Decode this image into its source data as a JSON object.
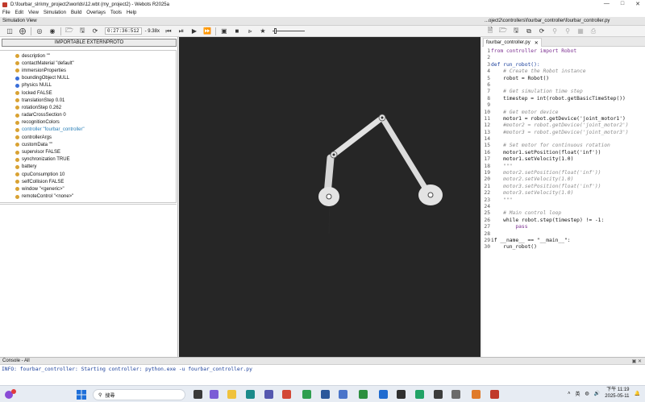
{
  "window": {
    "title": "D:\\fourbar_sln\\my_project2\\worlds\\12.wbt (my_project2) - Webots R2025a"
  },
  "menu": [
    "File",
    "Edit",
    "View",
    "Simulation",
    "Build",
    "Overlays",
    "Tools",
    "Help"
  ],
  "simulation_view": {
    "label": "Simulation View",
    "time": "0:27:36:512",
    "speed": "- 9.38x"
  },
  "scene_tree": {
    "button_label": "IMPORTABLE EXTERNPROTO",
    "fields": [
      {
        "text": "description \"\"",
        "dot": "orange"
      },
      {
        "text": "contactMaterial \"default\"",
        "dot": "orange"
      },
      {
        "text": "immersionProperties",
        "dot": "orange"
      },
      {
        "text": "boundingObject NULL",
        "dot": "blue"
      },
      {
        "text": "physics NULL",
        "dot": "blue"
      },
      {
        "text": "locked FALSE",
        "dot": "orange"
      },
      {
        "text": "translationStep 0.01",
        "dot": "orange"
      },
      {
        "text": "rotationStep 0.262",
        "dot": "orange"
      },
      {
        "text": "radarCrossSection 0",
        "dot": "orange"
      },
      {
        "text": "recognitionColors",
        "dot": "orange"
      },
      {
        "text": "controller \"fourbar_controller\"",
        "dot": "orange",
        "highlight": true
      },
      {
        "text": "controllerArgs",
        "dot": "orange"
      },
      {
        "text": "customData \"\"",
        "dot": "orange"
      },
      {
        "text": "supervisor FALSE",
        "dot": "orange"
      },
      {
        "text": "synchronization TRUE",
        "dot": "orange"
      },
      {
        "text": "battery",
        "dot": "orange"
      },
      {
        "text": "cpuConsumption 10",
        "dot": "orange"
      },
      {
        "text": "selfCollision FALSE",
        "dot": "orange"
      },
      {
        "text": "window \"<generic>\"",
        "dot": "orange"
      },
      {
        "text": "remoteControl \"<none>\"",
        "dot": "orange"
      }
    ]
  },
  "editor": {
    "path": "...oject2\\controllers\\fourbar_controller\\fourbar_controller.py",
    "tab": "fourbar_controller.py",
    "line_numbers": [
      "1",
      "2",
      "3",
      "4",
      "5",
      "6",
      "7",
      "8",
      "9",
      "10",
      "11",
      "12",
      "13",
      "14",
      "15",
      "16",
      "17",
      "18",
      "19",
      "20",
      "21",
      "22",
      "23",
      "24",
      "25",
      "26",
      "27",
      "28",
      "29",
      "30"
    ],
    "lines": [
      {
        "t": "from controller import Robot",
        "c": "kw"
      },
      {
        "t": "",
        "c": ""
      },
      {
        "t": "def run_robot():",
        "c": "fn"
      },
      {
        "t": "    # Create the Robot instance",
        "c": "cm"
      },
      {
        "t": "    robot = Robot()",
        "c": ""
      },
      {
        "t": "",
        "c": ""
      },
      {
        "t": "    # Get simulation time step",
        "c": "cm"
      },
      {
        "t": "    timestep = int(robot.getBasicTimeStep())",
        "c": ""
      },
      {
        "t": "",
        "c": ""
      },
      {
        "t": "    # Get motor device",
        "c": "cm"
      },
      {
        "t": "    motor1 = robot.getDevice('joint_motor1')",
        "c": ""
      },
      {
        "t": "    #motor2 = robot.getDevice('joint_motor2')",
        "c": "cm"
      },
      {
        "t": "    #motor3 = robot.getDevice('joint_motor3')",
        "c": "cm"
      },
      {
        "t": "",
        "c": ""
      },
      {
        "t": "    # Set motor for continuous rotation",
        "c": "cm"
      },
      {
        "t": "    motor1.setPosition(float('inf'))",
        "c": ""
      },
      {
        "t": "    motor1.setVelocity(1.0)",
        "c": ""
      },
      {
        "t": "    \"\"\"",
        "c": "cm"
      },
      {
        "t": "    motor2.setPosition(float('inf'))",
        "c": "cm"
      },
      {
        "t": "    motor2.setVelocity(1.0)",
        "c": "cm"
      },
      {
        "t": "    motor3.setPosition(float('inf'))",
        "c": "cm"
      },
      {
        "t": "    motor3.setVelocity(1.0)",
        "c": "cm"
      },
      {
        "t": "    \"\"\"",
        "c": "cm"
      },
      {
        "t": "",
        "c": ""
      },
      {
        "t": "    # Main control loop",
        "c": "cm"
      },
      {
        "t": "    while robot.step(timestep) != -1:",
        "c": ""
      },
      {
        "t": "        pass",
        "c": "kw"
      },
      {
        "t": "",
        "c": ""
      },
      {
        "t": "if __name__ == \"__main__\":",
        "c": ""
      },
      {
        "t": "    run_robot()",
        "c": ""
      }
    ]
  },
  "console": {
    "title": "Console - All",
    "message": "INFO: fourbar_controller: Starting controller: python.exe -u fourbar_controller.py"
  },
  "taskbar": {
    "search_placeholder": "搜尋",
    "language": "英",
    "time": "下午 11:19",
    "date": "2025-05-11"
  },
  "colors": {
    "viewport_bg": "#262626",
    "link_gray": "#e6e6e6",
    "accent_blue": "#1a3f9b"
  }
}
